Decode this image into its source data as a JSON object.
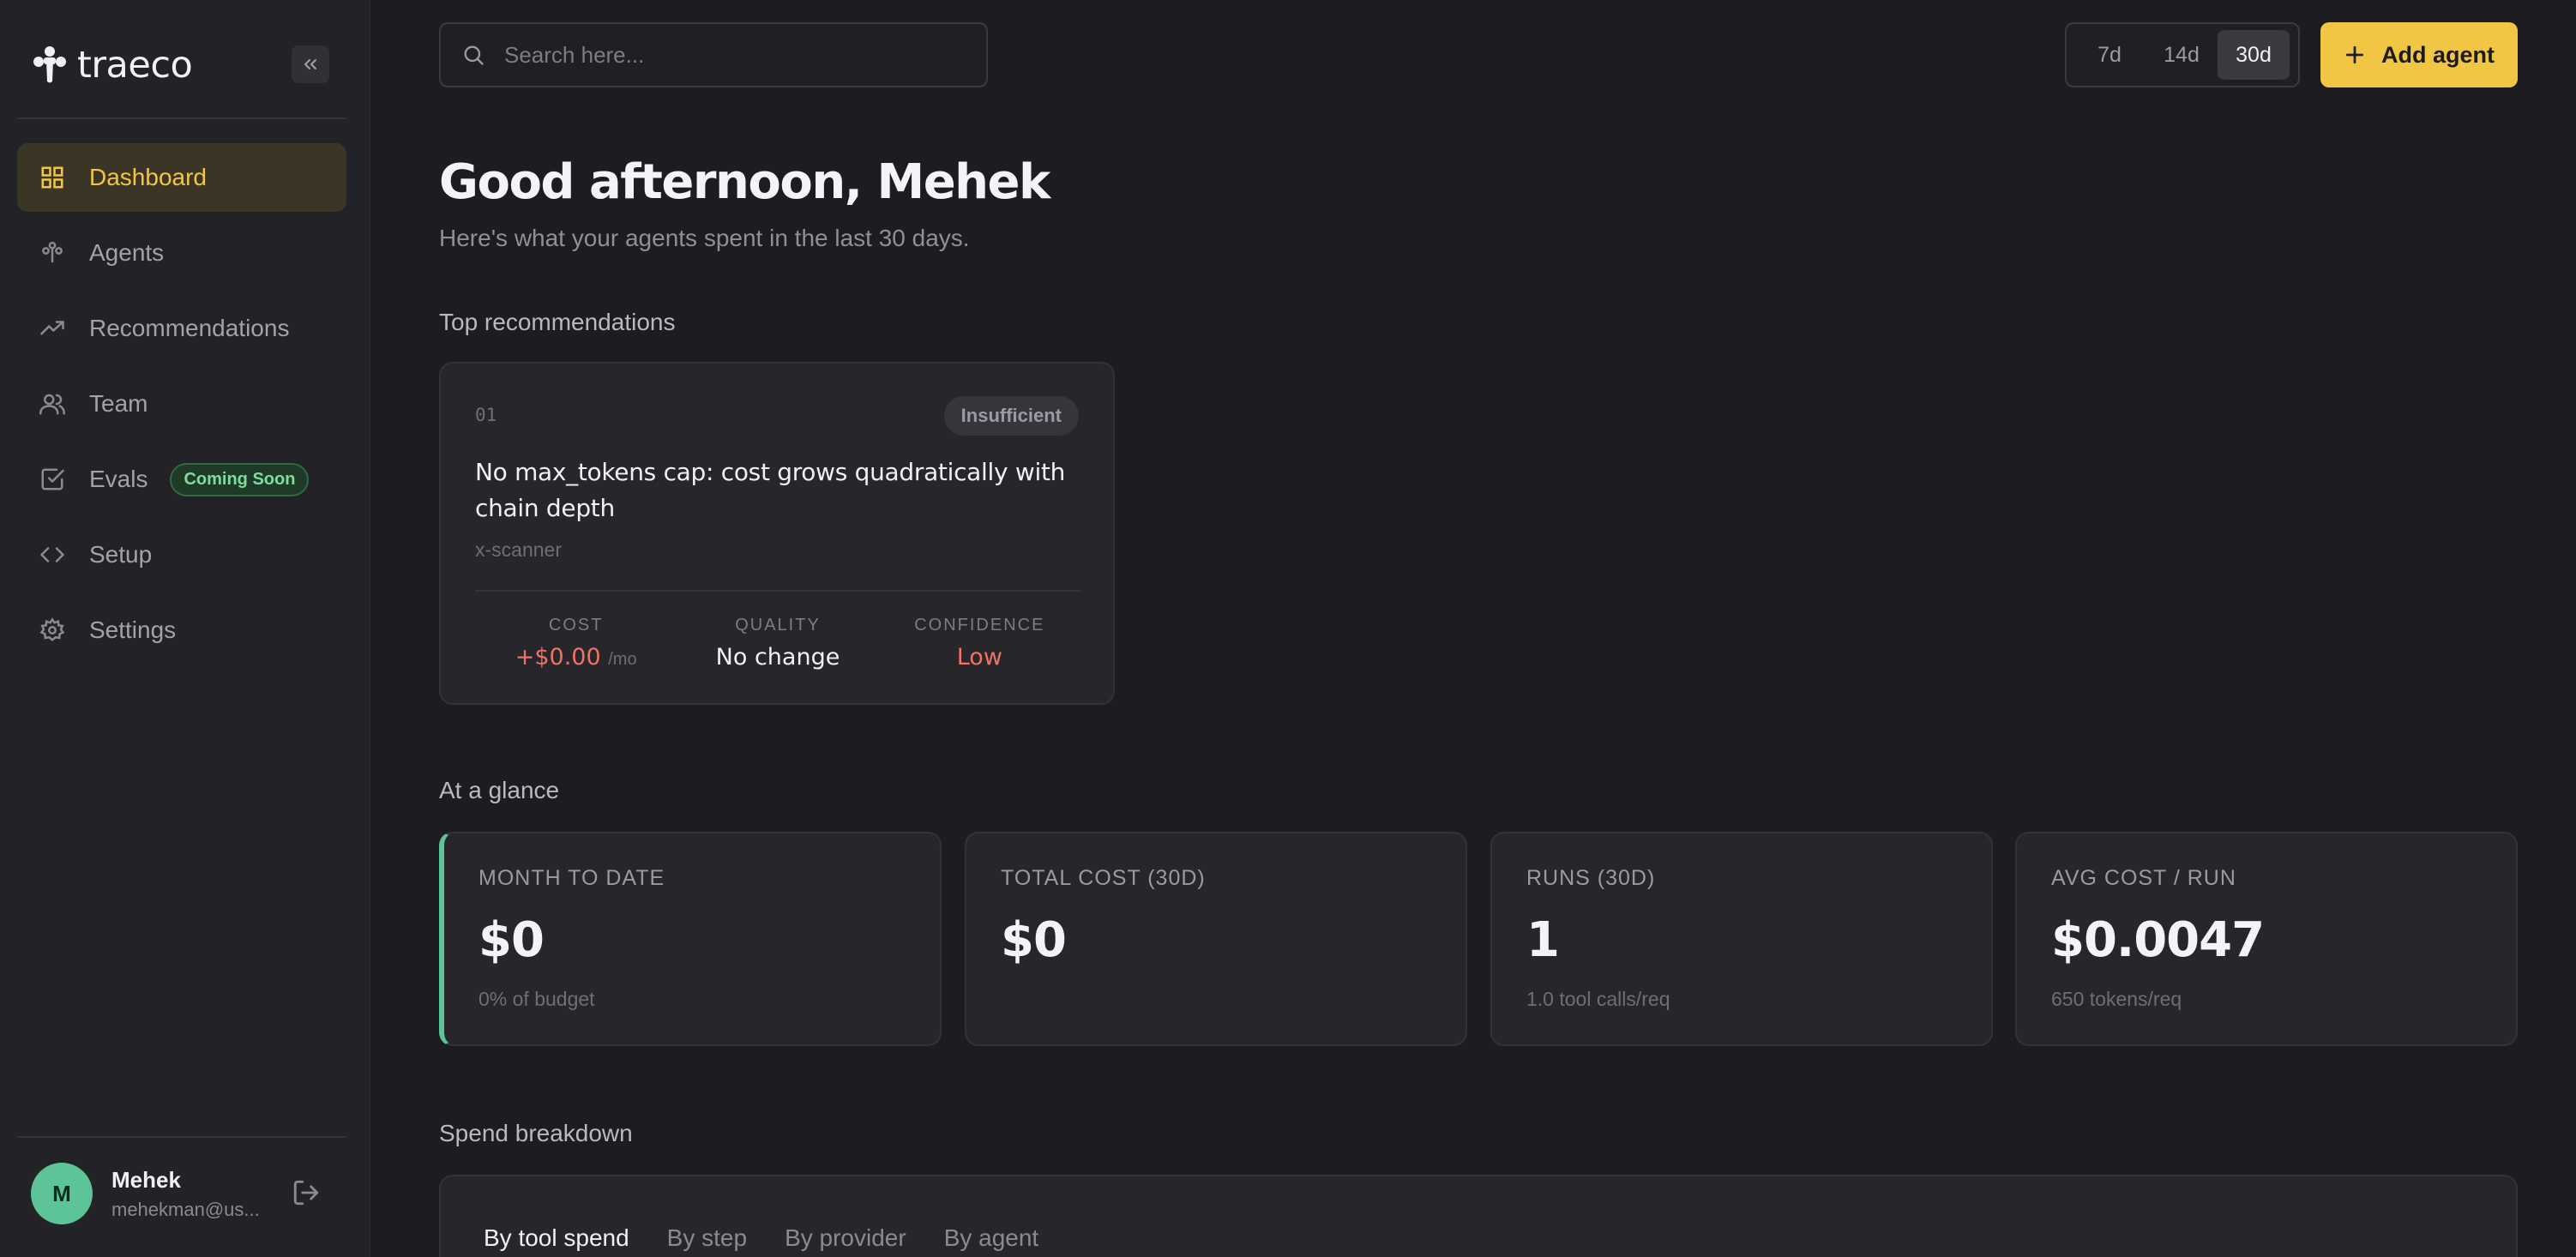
{
  "brand": {
    "name": "traeco"
  },
  "sidebar": {
    "items": [
      {
        "label": "Dashboard",
        "active": true
      },
      {
        "label": "Agents"
      },
      {
        "label": "Recommendations"
      },
      {
        "label": "Team"
      },
      {
        "label": "Evals",
        "badge": "Coming Soon"
      },
      {
        "label": "Setup"
      },
      {
        "label": "Settings"
      }
    ]
  },
  "user": {
    "initial": "M",
    "name": "Mehek",
    "email": "mehekman@us..."
  },
  "search": {
    "placeholder": "Search here..."
  },
  "range": {
    "options": [
      "7d",
      "14d",
      "30d"
    ],
    "selected": "30d"
  },
  "add_agent": {
    "label": "Add agent"
  },
  "greeting": {
    "title": "Good afternoon, Mehek",
    "subtitle": "Here's what your agents spent in the last 30 days."
  },
  "recommendations": {
    "title": "Top recommendations",
    "items": [
      {
        "number": "01",
        "badge": "Insufficient",
        "title": "No max_tokens cap: cost grows quadratically with chain depth",
        "agent": "x-scanner",
        "metrics": [
          {
            "label": "COST",
            "value": "+$0.00",
            "unit": "/mo"
          },
          {
            "label": "QUALITY",
            "value": "No change"
          },
          {
            "label": "CONFIDENCE",
            "value": "Low"
          }
        ]
      }
    ]
  },
  "glance": {
    "title": "At a glance",
    "cards": [
      {
        "label": "MONTH TO DATE",
        "value": "$0",
        "sub": "0% of budget"
      },
      {
        "label": "TOTAL COST (30D)",
        "value": "$0",
        "sub": ""
      },
      {
        "label": "RUNS (30D)",
        "value": "1",
        "sub": "1.0 tool calls/req"
      },
      {
        "label": "AVG COST / RUN",
        "value": "$0.0047",
        "sub": "650 tokens/req"
      }
    ]
  },
  "breakdown": {
    "title": "Spend breakdown",
    "tabs": [
      "By tool spend",
      "By step",
      "By provider",
      "By agent"
    ],
    "selected": "By tool spend"
  },
  "colors": {
    "accent": "#f1c644",
    "success": "#5cc497",
    "danger": "#f07166",
    "background": "#1d1d21"
  }
}
